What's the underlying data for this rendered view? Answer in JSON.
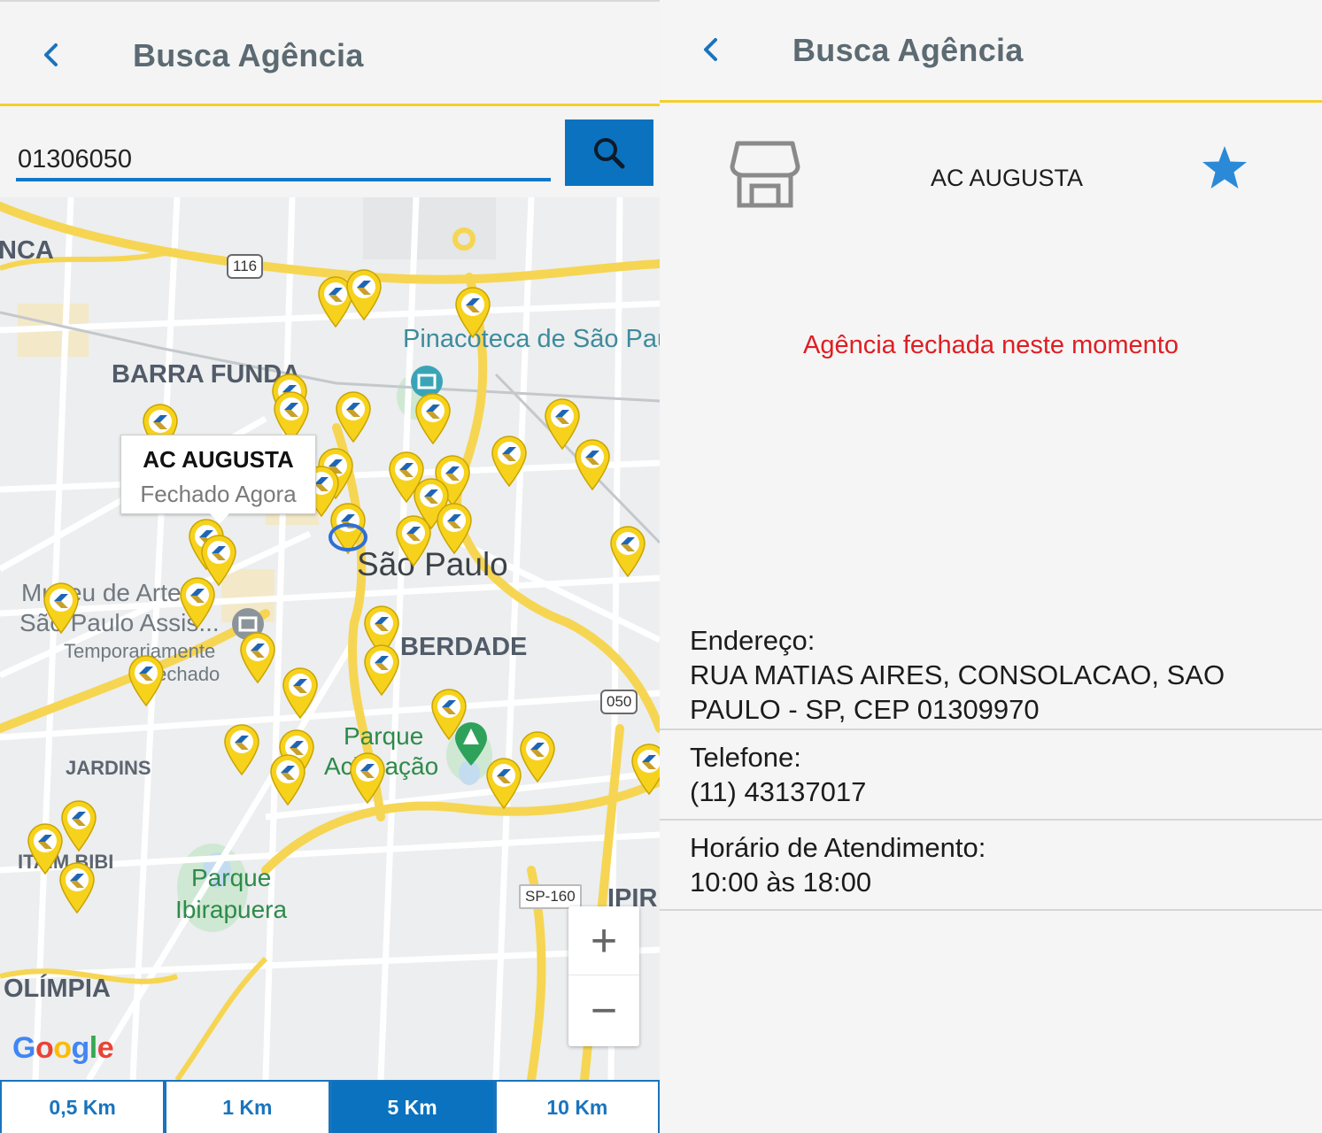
{
  "colors": {
    "accent_blue": "#0a72bf",
    "header_divider": "#f4cf2c",
    "pin_yellow": "#f7d21c",
    "closed_red": "#df1e23"
  },
  "left": {
    "header": {
      "back_icon": "chevron-left-icon",
      "title": "Busca Agência"
    },
    "search": {
      "value": "01306050",
      "button_icon": "search-icon"
    },
    "map": {
      "labels": {
        "nca": "NCA",
        "barra_funda": "BARRA FUNDA",
        "pinacoteca": "Pinacoteca de São Pau",
        "sao_paulo": "São Paulo",
        "museu_1": "Museu de Arte de",
        "museu_2": "São Paulo Assis...",
        "museu_3": "Temporariamente",
        "museu_4": "fechado",
        "liberdade": "BERDADE",
        "jardins": "JARDINS",
        "parque_aclim_1": "Parque",
        "parque_aclim_2": "Aclimação",
        "itaim": "ITAIM BIBI",
        "parque_ibira_1": "Parque",
        "parque_ibira_2": "Ibirapuera",
        "ipir": "IPIR",
        "olimpia": "OLÍMPIA",
        "road_116": "116",
        "road_050": "050",
        "road_sp160": "SP-160"
      },
      "info_window": {
        "title": "AC AUGUSTA",
        "status": "Fechado Agora"
      },
      "zoom": {
        "in": "+",
        "out": "−"
      },
      "attribution": "Google"
    },
    "radius_tabs": [
      {
        "label": "0,5 Km",
        "active": false
      },
      {
        "label": "1 Km",
        "active": false
      },
      {
        "label": "5 Km",
        "active": true
      },
      {
        "label": "10 Km",
        "active": false
      }
    ]
  },
  "right": {
    "header": {
      "back_icon": "chevron-left-icon",
      "title": "Busca Agência"
    },
    "agency": {
      "icon": "store-icon",
      "name": "AC AUGUSTA",
      "favorite_icon": "star-icon",
      "status_message": "Agência fechada neste momento"
    },
    "details": {
      "address_label": "Endereço:",
      "address_line1": "RUA MATIAS AIRES, CONSOLACAO, SAO",
      "address_line2": "PAULO - SP, CEP 01309970",
      "phone_label": "Telefone:",
      "phone_value": "(11) 43137017",
      "hours_label": "Horário de Atendimento:",
      "hours_value": "10:00 às 18:00"
    }
  }
}
